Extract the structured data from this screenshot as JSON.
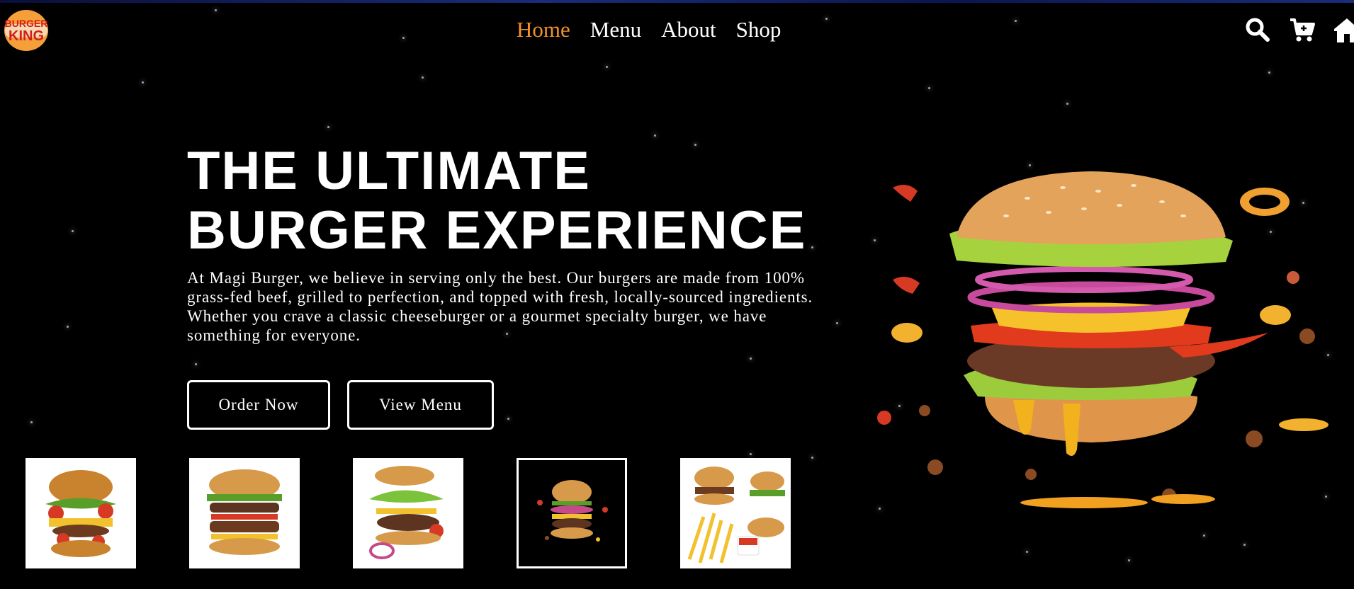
{
  "brand": {
    "logo_line1": "BURGER",
    "logo_line2": "KING",
    "logo_bun_color": "#f59f3a",
    "logo_text_color": "#d21e1e"
  },
  "nav": {
    "items": [
      {
        "label": "Home",
        "active": true
      },
      {
        "label": "Menu",
        "active": false
      },
      {
        "label": "About",
        "active": false
      },
      {
        "label": "Shop",
        "active": false
      }
    ],
    "active_color": "#f0922a",
    "icons": [
      "search-icon",
      "cart-icon",
      "home-icon"
    ]
  },
  "hero": {
    "title_line1": "THE ULTIMATE",
    "title_line2": "BURGER EXPERIENCE",
    "description": "At Magi Burger, we believe in serving only the best. Our burgers are made from 100% grass-fed beef, grilled to perfection, and topped with fresh, locally-sourced ingredients. Whether you crave a classic cheeseburger or a gourmet specialty burger, we have something for everyone.",
    "order_button": "Order Now",
    "menu_button": "View Menu"
  },
  "thumbnails": [
    "burger-thumbnail",
    "burger-thumbnail",
    "burger-thumbnail",
    "burger-thumbnail",
    "burger-fries-thumbnail"
  ]
}
